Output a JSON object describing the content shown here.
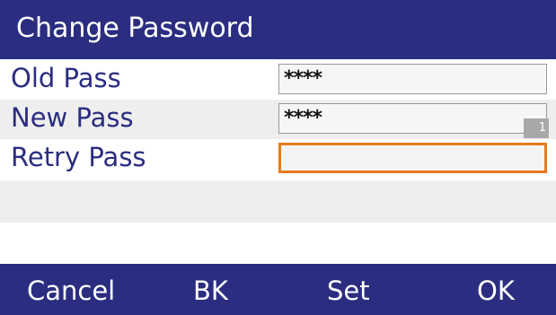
{
  "title": "Change Password",
  "rows": [
    {
      "label": "Old Pass",
      "value": "****"
    },
    {
      "label": "New Pass",
      "value": "****",
      "input_mode_indicator": "1"
    },
    {
      "label": "Retry Pass",
      "value": ""
    }
  ],
  "softkeys": {
    "cancel": "Cancel",
    "back": "BK",
    "set": "Set",
    "ok": "OK"
  },
  "colors": {
    "title_bar": "#2a2d80",
    "label_text": "#2a2d80",
    "focus_border": "#e87a1e",
    "softkey_bar": "#2a2d80"
  }
}
